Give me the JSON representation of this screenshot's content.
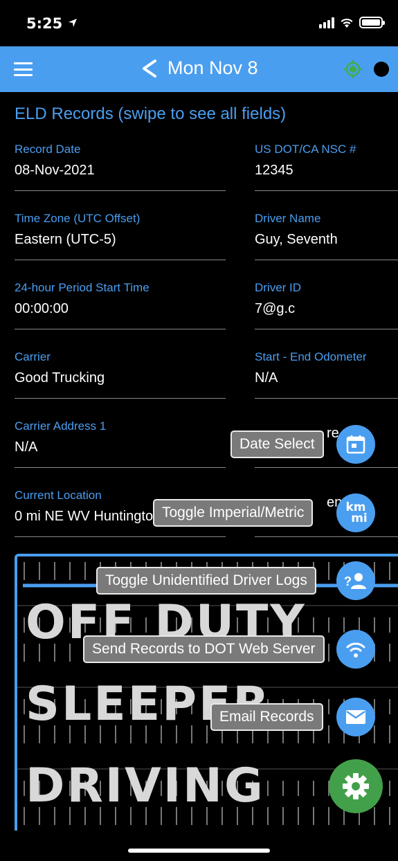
{
  "status_bar": {
    "time": "5:25"
  },
  "header": {
    "title": "Mon Nov 8"
  },
  "section_title": "ELD Records (swipe to see all fields)",
  "fields": [
    {
      "label": "Record Date",
      "value": "08-Nov-2021"
    },
    {
      "label": "US DOT/CA NSC #",
      "value": "12345"
    },
    {
      "label": "Time Zone (UTC Offset)",
      "value": "Eastern (UTC-5)"
    },
    {
      "label": "Driver Name",
      "value": "Guy, Seventh"
    },
    {
      "label": "24-hour Period Start Time",
      "value": "00:00:00"
    },
    {
      "label": "Driver ID",
      "value": "7@g.c"
    },
    {
      "label": "Carrier",
      "value": "Good Trucking"
    },
    {
      "label": "Start - End Odometer",
      "value": "N/A"
    },
    {
      "label": "Carrier Address 1",
      "value": "N/A"
    },
    {
      "label": "",
      "value": "re"
    },
    {
      "label": "Current Location",
      "value": "0 mi NE WV Huntingto"
    },
    {
      "label": "",
      "value": "en"
    }
  ],
  "graph": {
    "statuses": [
      "OFF DUTY",
      "SLEEPER",
      "DRIVING"
    ]
  },
  "fab_menu": {
    "items": [
      {
        "label": "Date Select",
        "icon": "calendar-icon"
      },
      {
        "label": "Toggle Imperial/Metric",
        "icon_text_top": "km",
        "icon_text_bottom": "mi"
      },
      {
        "label": "Toggle Unidentified Driver Logs",
        "icon": "unidentified-driver-icon"
      },
      {
        "label": "Send Records to DOT Web Server",
        "icon": "wifi-icon"
      },
      {
        "label": "Email Records",
        "icon": "email-icon"
      }
    ],
    "main_icon": "gear-icon"
  },
  "colors": {
    "accent": "#4a9ef0",
    "fab_main": "#43a04a",
    "gps": "#3fae49"
  }
}
